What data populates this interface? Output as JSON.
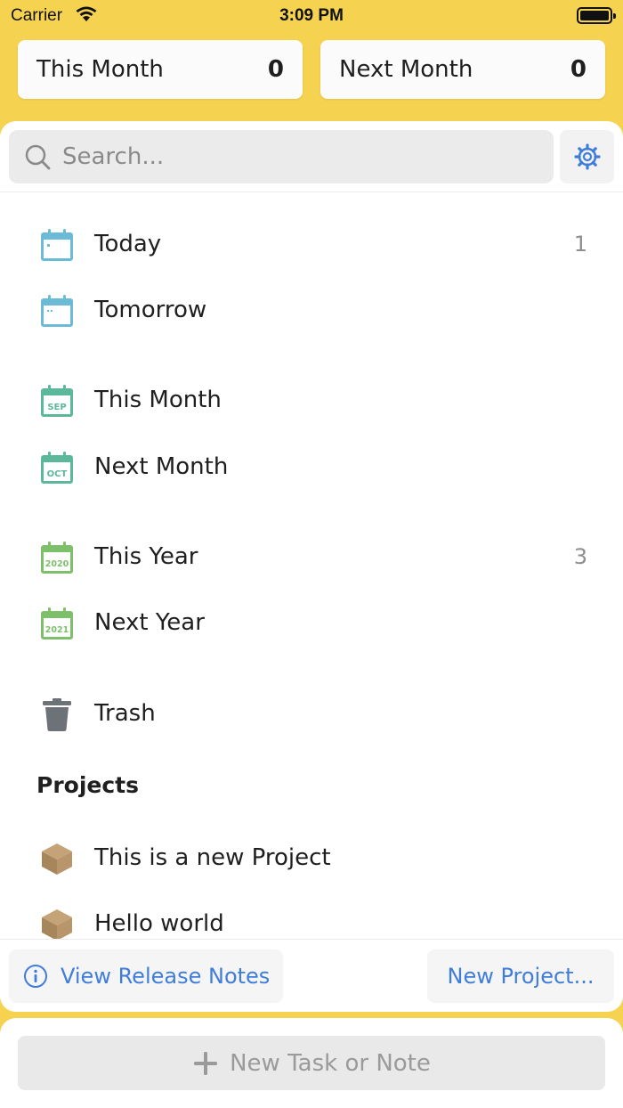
{
  "status_bar": {
    "carrier": "Carrier",
    "time": "3:09 PM"
  },
  "summary": [
    {
      "label": "This Month",
      "count": "0"
    },
    {
      "label": "Next Month",
      "count": "0"
    }
  ],
  "search": {
    "placeholder": "Search..."
  },
  "nav": [
    {
      "label": "Today",
      "badge": "1",
      "icon": "calendar-today-icon"
    },
    {
      "label": "Tomorrow",
      "badge": "",
      "icon": "calendar-tomorrow-icon"
    },
    {
      "label": "This Month",
      "badge": "",
      "icon": "calendar-month-icon",
      "icon_text": "SEP"
    },
    {
      "label": "Next Month",
      "badge": "",
      "icon": "calendar-month-icon",
      "icon_text": "OCT"
    },
    {
      "label": "This Year",
      "badge": "3",
      "icon": "calendar-year-icon",
      "icon_text": "2020"
    },
    {
      "label": "Next Year",
      "badge": "",
      "icon": "calendar-year-icon",
      "icon_text": "2021"
    },
    {
      "label": "Trash",
      "badge": "",
      "icon": "trash-icon"
    }
  ],
  "projects": {
    "title": "Projects",
    "items": [
      {
        "label": "This is a new Project",
        "icon": "project-box-icon"
      },
      {
        "label": "Hello world",
        "icon": "project-box-icon"
      }
    ]
  },
  "footer": {
    "release_notes": "View Release Notes",
    "new_project": "New Project..."
  },
  "bottom": {
    "new_task": "New Task or Note"
  },
  "colors": {
    "background": "#f5d250",
    "accent": "#3f7ddb",
    "calendar_blue": "#6bbad6",
    "calendar_teal": "#5cb89a",
    "calendar_green": "#7dbf6a",
    "trash": "#6d7178",
    "project_box": "#b08c62"
  }
}
